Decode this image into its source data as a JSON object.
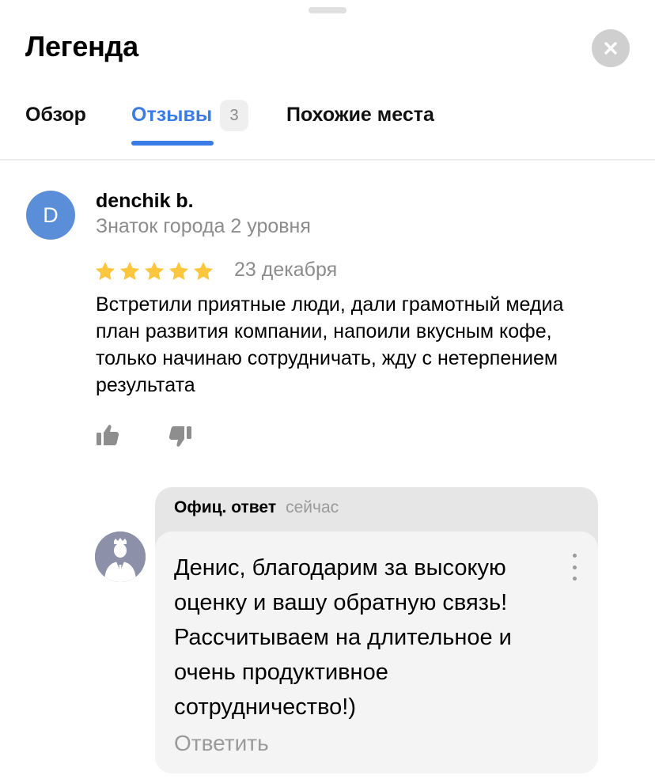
{
  "header": {
    "title": "Легенда"
  },
  "tabs": [
    {
      "label": "Обзор",
      "active": false
    },
    {
      "label": "Отзывы",
      "count": "3",
      "active": true
    },
    {
      "label": "Похожие места",
      "active": false
    }
  ],
  "review": {
    "avatar_letter": "D",
    "author": "denchik b.",
    "level": "Знаток города 2 уровня",
    "rating": 5,
    "max_rating": 5,
    "date": "23 декабря",
    "text": "Встретили приятные люди, дали грамотный медиа план развития компании, напоили вкусным кофе, только начинаю сотрудничать, жду с нетерпением результата"
  },
  "official_reply": {
    "label": "Офиц. ответ",
    "time": "сейчас",
    "text": "Денис, благодарим за высокую оценку и вашу обратную связь! Рассчитываем на длительное и очень продуктивное сотрудничество!)",
    "answer_label": "Ответить"
  },
  "colors": {
    "accent": "#3b7be6",
    "star": "#fcc73f",
    "avatar": "#5b8ed8",
    "muted_text": "#8c8c8c"
  },
  "icons": [
    "close-icon",
    "star-icon",
    "thumbs-up-icon",
    "thumbs-down-icon",
    "more-vertical-icon",
    "org-avatar-icon"
  ]
}
